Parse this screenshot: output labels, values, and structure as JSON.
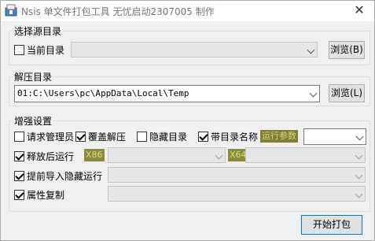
{
  "window": {
    "title": "Nsis 单文件打包工具 无忧启动2307005 制作",
    "close_glyph": "✕"
  },
  "source_group": {
    "legend": "选择源目录",
    "current_dir_label": "当前目录",
    "current_dir_checked": false,
    "path_value": "",
    "browse_label": "浏览(B)"
  },
  "extract_group": {
    "legend": "解压目录",
    "path_value": "01:C:\\Users\\pc\\AppData\\Local\\Temp",
    "browse_label": "浏览(L)"
  },
  "enhance_group": {
    "legend": "增强设置",
    "request_admin": {
      "label": "请求管理员",
      "checked": false
    },
    "overwrite": {
      "label": "覆盖解压",
      "checked": true
    },
    "hide_dir": {
      "label": "隐藏目录",
      "checked": false
    },
    "with_dir_name": {
      "label": "带目录名称",
      "checked": true
    },
    "run_params_tag": "运行参数",
    "run_params_value": "",
    "run_after": {
      "label": "释放后运行",
      "checked": true
    },
    "x86_tag": "X86",
    "x64_tag": "X64",
    "pre_import": {
      "label": "提前导入隐藏运行",
      "checked": true
    },
    "copy_attr": {
      "label": "属性复制",
      "checked": true
    }
  },
  "pack_button_label": "开始打包"
}
